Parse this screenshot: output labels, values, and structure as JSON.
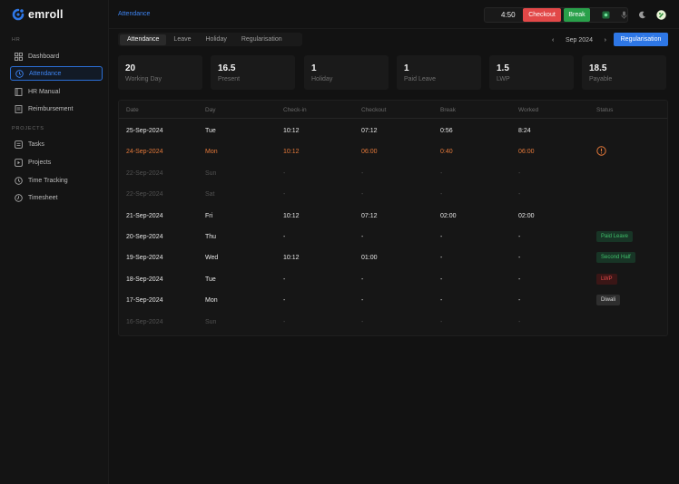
{
  "app": {
    "brand": "emroll"
  },
  "sidebar": {
    "section_hr": "HR",
    "section_projects": "PROJECTS",
    "hr_items": [
      {
        "label": "Dashboard",
        "icon": "grid-icon"
      },
      {
        "label": "Attendance",
        "icon": "clock-icon",
        "active": true
      },
      {
        "label": "HR Manual",
        "icon": "book-icon"
      },
      {
        "label": "Reimbursement",
        "icon": "receipt-icon"
      }
    ],
    "project_items": [
      {
        "label": "Tasks",
        "icon": "list-icon"
      },
      {
        "label": "Projects",
        "icon": "folder-icon"
      },
      {
        "label": "Time Tracking",
        "icon": "clock-icon"
      },
      {
        "label": "Timesheet",
        "icon": "calendar-icon"
      }
    ]
  },
  "topbar": {
    "breadcrumb": "Attendance",
    "timer": "4:50",
    "checkout_label": "Checkout",
    "break_label": "Break"
  },
  "tabs": [
    "Attendance",
    "Leave",
    "Holiday",
    "Regularisation"
  ],
  "month_nav": {
    "label": "Sep 2024",
    "prev": "‹",
    "next": "›"
  },
  "regularisation_button": "Regularisation",
  "stats": [
    {
      "value": "20",
      "label": "Working Day"
    },
    {
      "value": "16.5",
      "label": "Present"
    },
    {
      "value": "1",
      "label": "Holiday"
    },
    {
      "value": "1",
      "label": "Paid Leave"
    },
    {
      "value": "1.5",
      "label": "LWP"
    },
    {
      "value": "18.5",
      "label": "Payable"
    }
  ],
  "table": {
    "columns": [
      "Date",
      "Day",
      "Check-in",
      "Checkout",
      "Break",
      "Worked",
      "Status"
    ],
    "rows": [
      {
        "date": "25-Sep-2024",
        "day": "Tue",
        "checkin": "10:12",
        "checkout": "07:12",
        "break": "0:56",
        "worked": "8:24",
        "status": "",
        "style": "normal"
      },
      {
        "date": "24-Sep-2024",
        "day": "Mon",
        "checkin": "10:12",
        "checkout": "06:00",
        "break": "0:40",
        "worked": "06:00",
        "status": "",
        "style": "orange",
        "warning": true
      },
      {
        "date": "22-Sep-2024",
        "day": "Sun",
        "checkin": "-",
        "checkout": "-",
        "break": "-",
        "worked": "-",
        "status": "",
        "style": "dim"
      },
      {
        "date": "22-Sep-2024",
        "day": "Sat",
        "checkin": "-",
        "checkout": "-",
        "break": "-",
        "worked": "-",
        "status": "",
        "style": "dim"
      },
      {
        "date": "21-Sep-2024",
        "day": "Fri",
        "checkin": "10:12",
        "checkout": "07:12",
        "break": "02:00",
        "worked": "02:00",
        "status": "",
        "style": "normal"
      },
      {
        "date": "20-Sep-2024",
        "day": "Thu",
        "checkin": "-",
        "checkout": "-",
        "break": "-",
        "worked": "-",
        "status": "Paid Leave",
        "badge": "green",
        "style": "normal"
      },
      {
        "date": "19-Sep-2024",
        "day": "Wed",
        "checkin": "10:12",
        "checkout": "01:00",
        "break": "-",
        "worked": "-",
        "status": "Second Half",
        "badge": "green",
        "style": "normal"
      },
      {
        "date": "18-Sep-2024",
        "day": "Tue",
        "checkin": "-",
        "checkout": "-",
        "break": "-",
        "worked": "-",
        "status": "LWP",
        "badge": "red",
        "style": "normal"
      },
      {
        "date": "17-Sep-2024",
        "day": "Mon",
        "checkin": "-",
        "checkout": "-",
        "break": "-",
        "worked": "-",
        "status": "Diwali",
        "badge": "gray",
        "style": "normal"
      },
      {
        "date": "16-Sep-2024",
        "day": "Sun",
        "checkin": "-",
        "checkout": "-",
        "break": "-",
        "worked": "-",
        "status": "",
        "style": "dim"
      }
    ]
  },
  "colors": {
    "accent": "#2e77e6",
    "checkout": "#e24848",
    "break": "#29a04a",
    "warning": "#e5793a"
  }
}
